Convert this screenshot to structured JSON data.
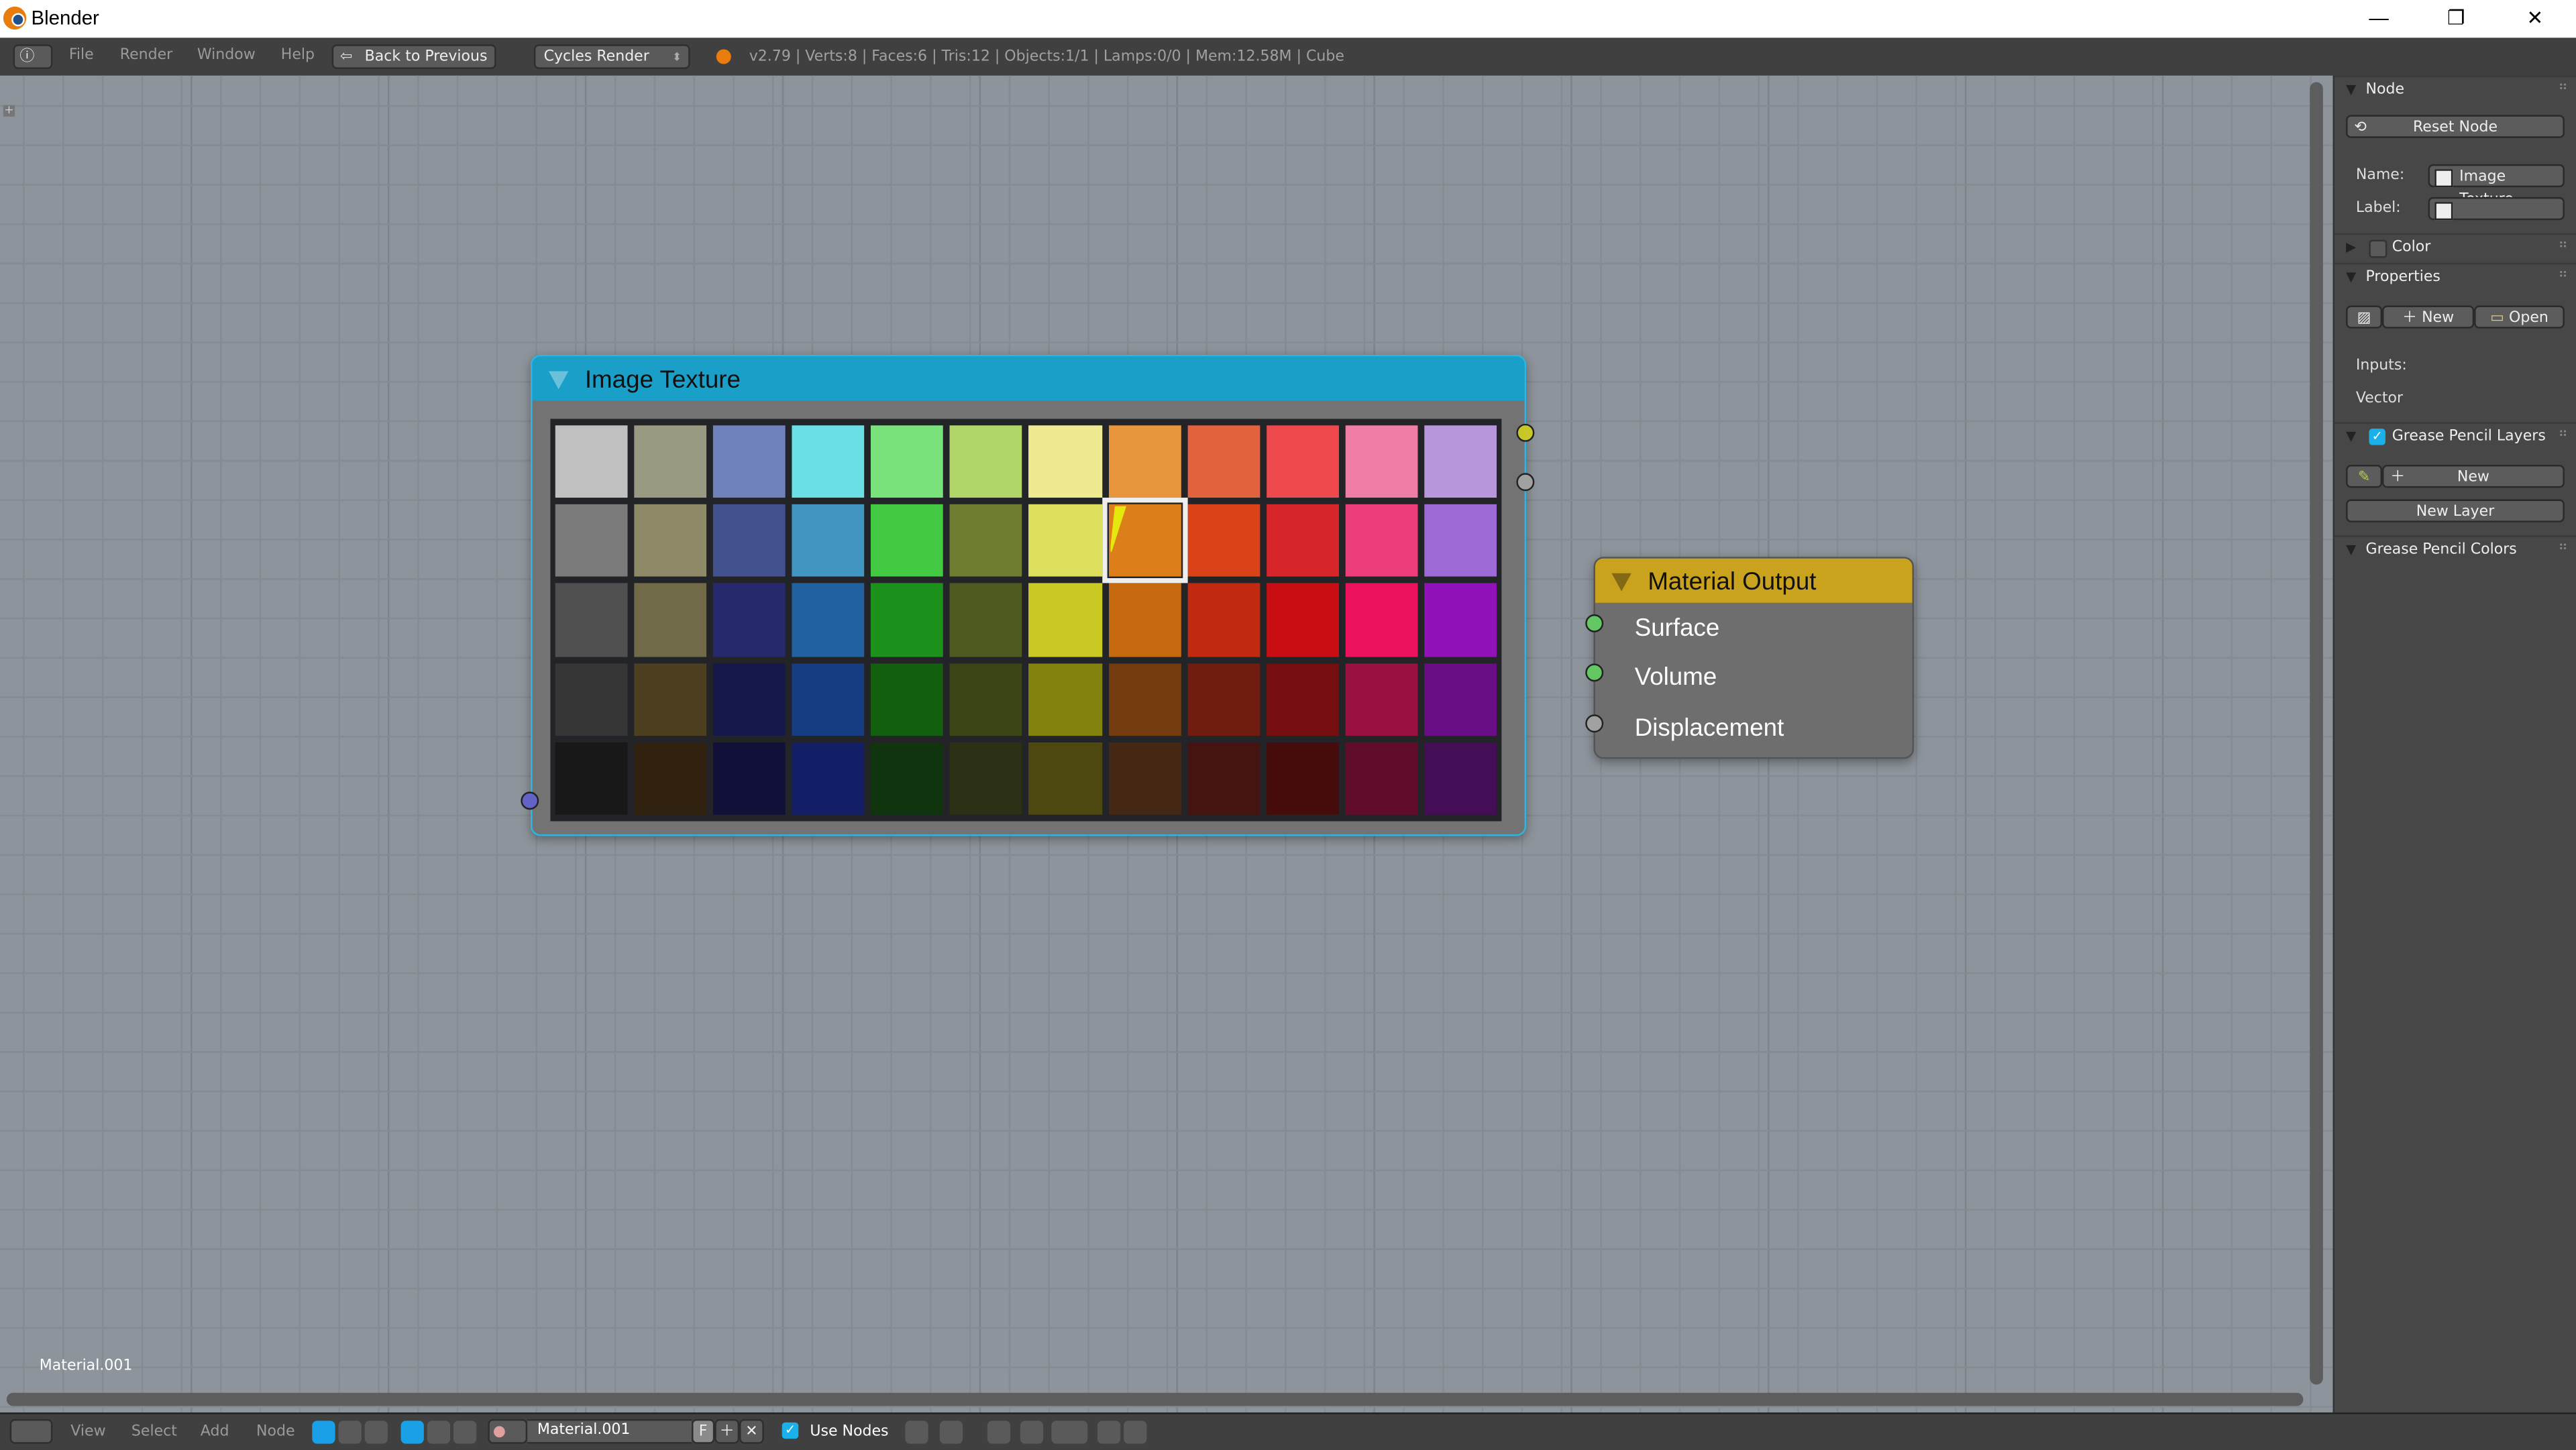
{
  "window": {
    "title": "Blender",
    "minimize": "—",
    "restore": "❐",
    "close": "✕"
  },
  "header": {
    "menus": [
      "File",
      "Render",
      "Window",
      "Help"
    ],
    "back_button": "Back to Previous",
    "render_engine": "Cycles Render",
    "stats": "v2.79 | Verts:8 | Faces:6 | Tris:12 | Objects:1/1 | Lamps:0/0 | Mem:12.58M | Cube"
  },
  "canvas": {
    "material_label": "Material.001",
    "image_texture_node": {
      "title": "Image Texture",
      "header_color": "#1aa0c8",
      "palette_rows": [
        [
          "#c0c0c0",
          "#9a9a82",
          "#6f82bc",
          "#6adfe6",
          "#7ae27a",
          "#b2d56a",
          "#eeea92",
          "#e8963e",
          "#e2623e",
          "#ee4a4e",
          "#ee7ea6",
          "#b896dc"
        ],
        [
          "#7a7a7a",
          "#8e8a68",
          "#42528e",
          "#4296c2",
          "#42ca42",
          "#6e7e30",
          "#dedf5e",
          "#dc7e1a",
          "#dc4218",
          "#d6262a",
          "#ec3e7a",
          "#9e6ad8"
        ],
        [
          "#505050",
          "#706a48",
          "#262a6c",
          "#2262a0",
          "#1c921c",
          "#4e5a20",
          "#cac822",
          "#c66a10",
          "#c22a10",
          "#c80e12",
          "#ec1260",
          "#9012b8"
        ],
        [
          "#363636",
          "#4c4020",
          "#16184c",
          "#163c82",
          "#12600e",
          "#3a4616",
          "#84820e",
          "#723c10",
          "#701c10",
          "#760e10",
          "#9a1040",
          "#6a0e86"
        ],
        [
          "#181818",
          "#30220e",
          "#101038",
          "#121e66",
          "#10340e",
          "#2c3014",
          "#4c4810",
          "#442814",
          "#461410",
          "#460c0c",
          "#620c2c",
          "#440e56"
        ]
      ]
    },
    "material_output_node": {
      "title": "Material Output",
      "header_color": "#c9a21e",
      "inputs": [
        "Surface",
        "Volume",
        "Displacement"
      ]
    }
  },
  "panel": {
    "node_section": "Node",
    "reset_node": "Reset Node",
    "name_label": "Name:",
    "name_value": "Image Texture",
    "label_label": "Label:",
    "label_value": "",
    "color_section": "Color",
    "properties_section": "Properties",
    "new_button": "New",
    "open_button": "Open",
    "inputs_label": "Inputs:",
    "vector_label": "Vector",
    "gp_layers_section": "Grease Pencil Layers",
    "gp_new_button": "New",
    "new_layer_button": "New Layer",
    "gp_colors_section": "Grease Pencil Colors"
  },
  "footer": {
    "menus": [
      "View",
      "Select",
      "Add",
      "Node"
    ],
    "material_name": "Material.001",
    "fake_user": "F",
    "use_nodes": "Use Nodes",
    "use_nodes_checked": true
  }
}
